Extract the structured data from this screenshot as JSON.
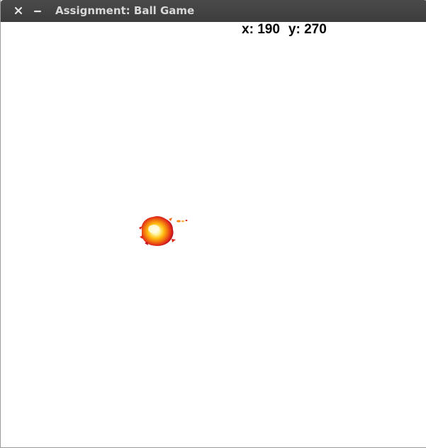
{
  "window": {
    "title": "Assignment: Ball Game",
    "close_icon": "close-icon",
    "minimize_icon": "minimize-icon"
  },
  "readout": {
    "x_label": "x:",
    "x_value": "190",
    "y_label": "y:",
    "y_value": "270"
  },
  "sprite": {
    "name": "fireball",
    "colors": {
      "core": "#fff6c0",
      "mid": "#ffb000",
      "outer": "#e8320a",
      "edge": "#c0101e"
    }
  },
  "colors": {
    "titlebar": "#3f3f3f",
    "title_text": "#d8d8d8",
    "canvas": "#ffffff"
  }
}
